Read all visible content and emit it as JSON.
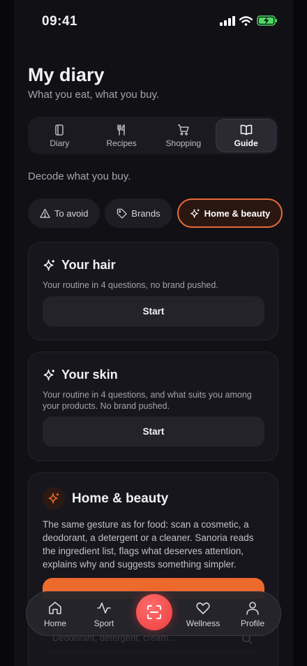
{
  "status": {
    "time": "09:41"
  },
  "header": {
    "title": "My diary",
    "subtitle": "What you eat, what you buy."
  },
  "tabs": [
    {
      "label": "Diary",
      "icon": "notebook-icon"
    },
    {
      "label": "Recipes",
      "icon": "fork-knife-icon"
    },
    {
      "label": "Shopping",
      "icon": "cart-icon"
    },
    {
      "label": "Guide",
      "icon": "book-icon",
      "active": true
    }
  ],
  "guide": {
    "intro": "Decode what you buy.",
    "chips": [
      {
        "label": "To avoid",
        "icon": "warning-icon"
      },
      {
        "label": "Brands",
        "icon": "tag-icon"
      },
      {
        "label": "Home & beauty",
        "icon": "sparkle-icon",
        "active": true
      }
    ]
  },
  "cards": {
    "hair": {
      "title": "Your hair",
      "desc": "Your routine in 4 questions, no brand pushed.",
      "button": "Start"
    },
    "skin": {
      "title": "Your skin",
      "desc": "Your routine in 4 questions, and what suits you among your products. No brand pushed.",
      "button": "Start"
    },
    "beauty": {
      "title": "Home & beauty",
      "desc": "The same gesture as for food: scan a cosmetic, a deodorant, a detergent or a cleaner. Sanoria reads the ingredient list, flags what deserves attention, explains why and suggests something simpler."
    }
  },
  "search": {
    "placeholder": "Deodorant, detergent, cream…"
  },
  "nav": {
    "items": [
      {
        "label": "Home",
        "icon": "home-icon"
      },
      {
        "label": "Sport",
        "icon": "activity-icon"
      },
      {
        "label": "Wellness",
        "icon": "heart-icon"
      },
      {
        "label": "Profile",
        "icon": "user-icon"
      }
    ],
    "scan_icon": "scan-icon"
  },
  "colors": {
    "accent": "#ec6a2c",
    "scan": "#ee3c3c",
    "battery": "#4cd964",
    "background": "#111015"
  }
}
